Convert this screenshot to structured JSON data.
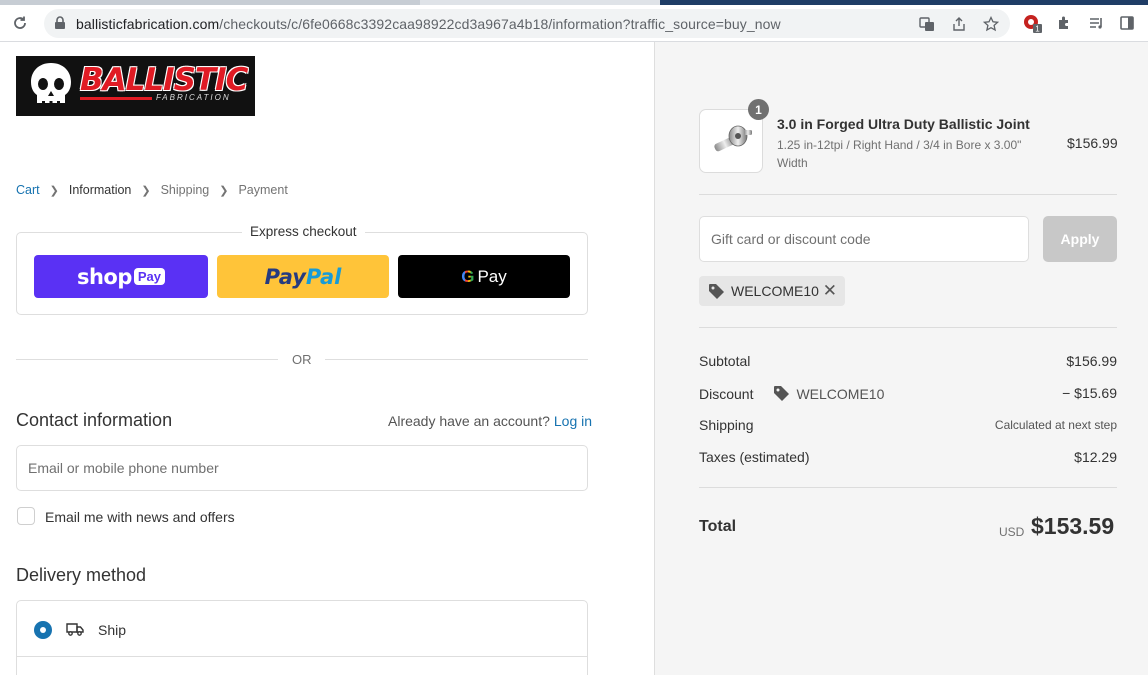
{
  "browser": {
    "url_host": "ballisticfabrication.com",
    "url_path": "/checkouts/c/6fe0668c3392caa98922cd3a967a4b18/information?traffic_source=buy_now",
    "extension_badge": "1"
  },
  "brand": {
    "logo_wordmark": "BALLISTIC",
    "logo_sub": "FABRICATION",
    "accent_color": "#e01b24",
    "link_color": "#1773b0"
  },
  "breadcrumb": {
    "cart": "Cart",
    "information": "Information",
    "shipping": "Shipping",
    "payment": "Payment"
  },
  "express": {
    "title": "Express checkout",
    "shoppay_word": "shop",
    "shoppay_pill": "Pay",
    "paypal_a": "Pay",
    "paypal_b": "Pal",
    "gpay_g": "G",
    "gpay_word": "Pay"
  },
  "divider_or": "OR",
  "contact": {
    "heading": "Contact information",
    "account_prompt": "Already have an account?",
    "login_label": "Log in",
    "email_placeholder": "Email or mobile phone number",
    "newsletter_label": "Email me with news and offers"
  },
  "delivery": {
    "heading": "Delivery method",
    "ship_label": "Ship"
  },
  "summary": {
    "item": {
      "quantity": "1",
      "name": "3.0 in Forged Ultra Duty Ballistic Joint",
      "variant": "1.25 in-12tpi / Right Hand / 3/4 in Bore x 3.00\" Width",
      "price": "$156.99"
    },
    "discount_placeholder": "Gift card or discount code",
    "apply_label": "Apply",
    "applied_code": "WELCOME10",
    "subtotal_label": "Subtotal",
    "subtotal_value": "$156.99",
    "discount_label": "Discount",
    "discount_code": "WELCOME10",
    "discount_value": "− $15.69",
    "shipping_label": "Shipping",
    "shipping_value": "Calculated at next step",
    "taxes_label": "Taxes (estimated)",
    "taxes_value": "$12.29",
    "total_label": "Total",
    "total_currency": "USD",
    "total_value": "$153.59"
  }
}
